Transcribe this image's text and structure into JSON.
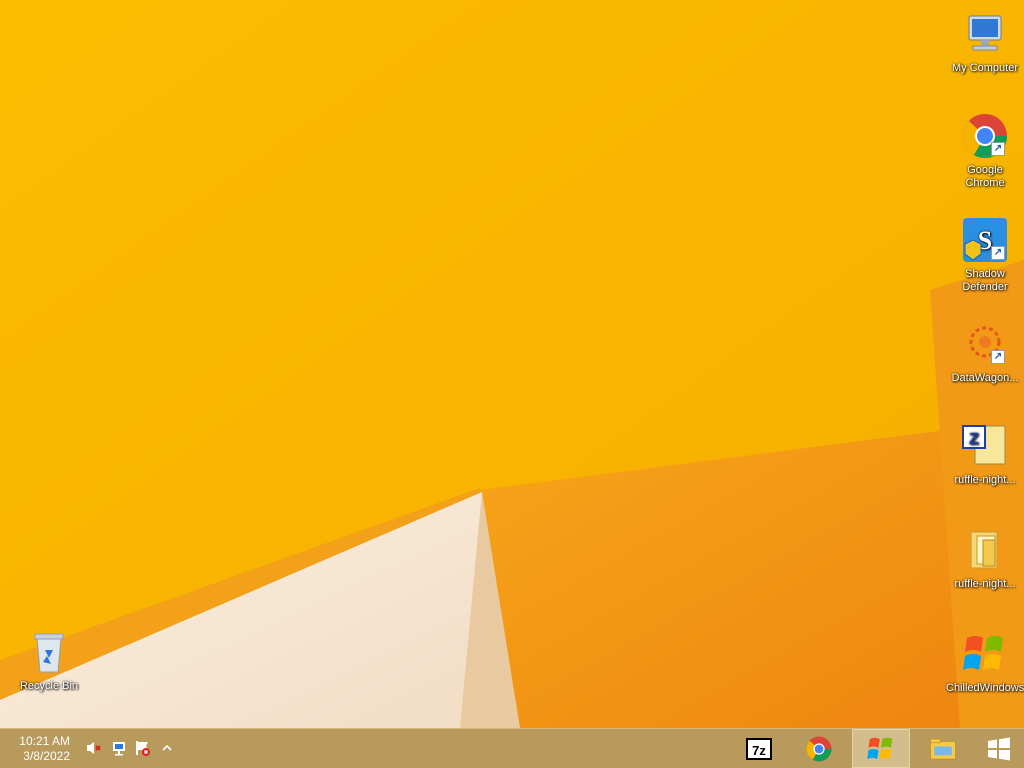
{
  "desktop": {
    "icons": [
      {
        "id": "my-computer",
        "label": "My Computer"
      },
      {
        "id": "google-chrome",
        "label": "Google Chrome"
      },
      {
        "id": "shadow-defender",
        "label": "Shadow Defender"
      },
      {
        "id": "datawagon",
        "label": "DataWagon..."
      },
      {
        "id": "ruffle-night-1",
        "label": "ruffle-night..."
      },
      {
        "id": "ruffle-night-2",
        "label": "ruffle-night..."
      },
      {
        "id": "chilledwindows",
        "label": "ChilledWindows"
      },
      {
        "id": "recycle-bin",
        "label": "Recycle Bin"
      }
    ]
  },
  "taskbar": {
    "clock_time": "10:21 AM",
    "clock_date": "3/8/2022",
    "buttons": [
      {
        "id": "start",
        "icon": "windows-logo-icon"
      },
      {
        "id": "file-explorer",
        "icon": "folder-icon"
      },
      {
        "id": "chilledwindows",
        "icon": "windows-xp-flag-icon",
        "active": true
      },
      {
        "id": "chrome",
        "icon": "chrome-icon"
      },
      {
        "id": "7zip",
        "icon": "7zip-icon",
        "label": "7z"
      }
    ],
    "tray": [
      "show-hidden-icons",
      "action-center-icon",
      "network-icon",
      "volume-muted-icon"
    ]
  },
  "colors": {
    "wallpaper": "#f8b800",
    "taskbar": "#b89a5c",
    "accent_orange": "#f08a10"
  }
}
